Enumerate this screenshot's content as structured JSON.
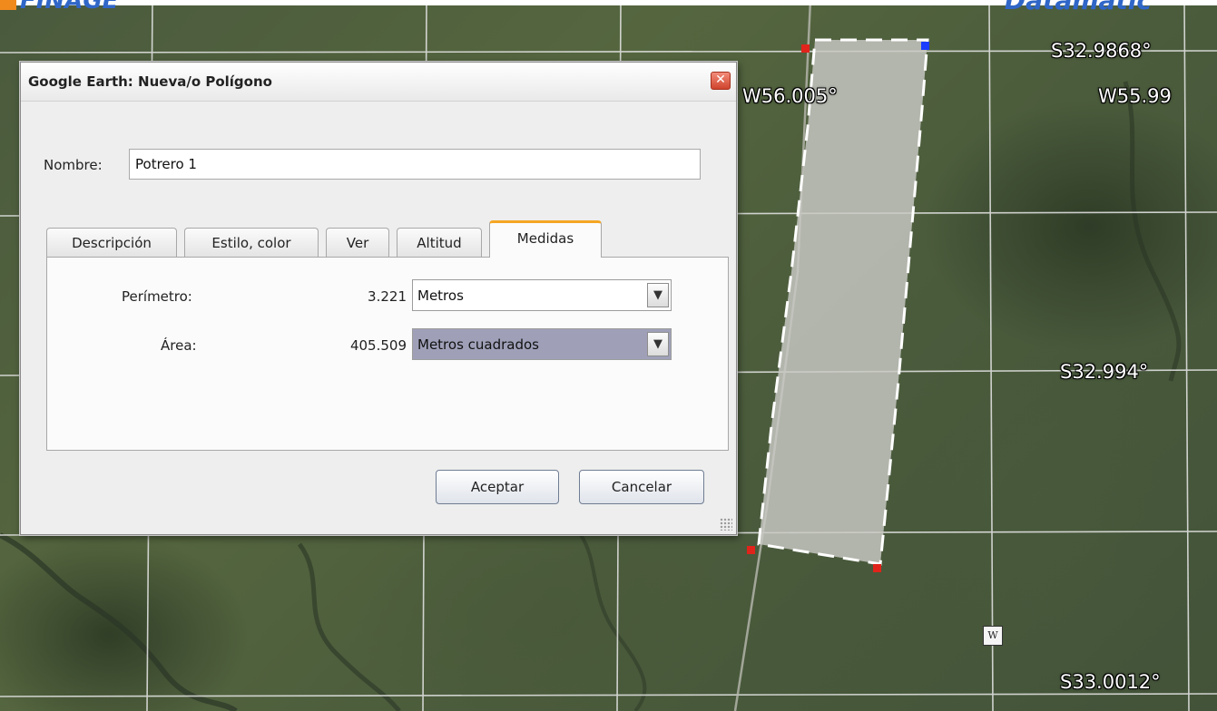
{
  "app": {
    "brand_left": "FINAGE",
    "brand_right": "Datamatic"
  },
  "map": {
    "coords": {
      "lat_top": "S32.9868°",
      "lon_left": "W56.005°",
      "lon_right": "W55.99",
      "lat_mid": "S32.994°",
      "lat_bottom": "S33.0012°"
    },
    "placemark_label": "W"
  },
  "dialog": {
    "title": "Google Earth: Nueva/o Polígono",
    "close_label": "✕",
    "name_label": "Nombre:",
    "name_value": "Potrero 1",
    "tabs": [
      {
        "label": "Descripción"
      },
      {
        "label": "Estilo, color"
      },
      {
        "label": "Ver"
      },
      {
        "label": "Altitud"
      },
      {
        "label": "Medidas"
      }
    ],
    "active_tab": "Medidas",
    "measures": {
      "perimeter_label": "Perímetro:",
      "perimeter_value": "3.221",
      "perimeter_unit": "Metros",
      "area_label": "Área:",
      "area_value": "405.509",
      "area_unit": "Metros cuadrados"
    },
    "ok_label": "Aceptar",
    "cancel_label": "Cancelar"
  },
  "colors": {
    "tab_accent": "#f5a623",
    "marker_red": "#e0241b",
    "marker_blue": "#1a3dff"
  }
}
